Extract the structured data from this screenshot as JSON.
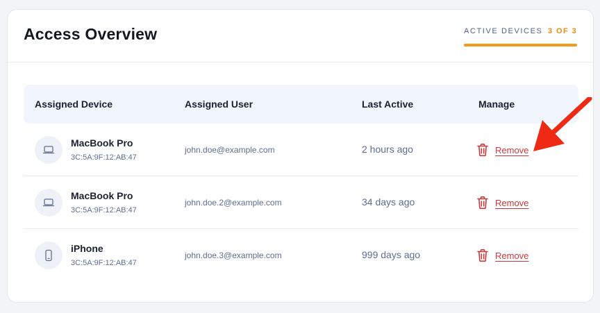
{
  "page": {
    "title": "Access Overview"
  },
  "tab": {
    "label": "ACTIVE DEVICES",
    "count": "3 OF 3",
    "accent": "#f29a1c"
  },
  "table": {
    "headers": {
      "device": "Assigned Device",
      "user": "Assigned User",
      "last_active": "Last Active",
      "manage": "Manage"
    },
    "rows": [
      {
        "icon": "laptop-icon",
        "device": "MacBook Pro",
        "mac": "3C:5A:9F:12:AB:47",
        "user": "john.doe@example.com",
        "last_active": "2 hours ago",
        "action": "Remove"
      },
      {
        "icon": "laptop-icon",
        "device": "MacBook Pro",
        "mac": "3C:5A:9F:12:AB:47",
        "user": "john.doe.2@example.com",
        "last_active": "34 days ago",
        "action": "Remove"
      },
      {
        "icon": "phone-icon",
        "device": "iPhone",
        "mac": "3C:5A:9F:12:AB:47",
        "user": "john.doe.3@example.com",
        "last_active": "999 days ago",
        "action": "Remove"
      }
    ]
  },
  "colors": {
    "remove": "#c8383b",
    "annotation_arrow": "#ee2a14"
  },
  "annotation": {
    "icon": "pointer-arrow-icon"
  }
}
